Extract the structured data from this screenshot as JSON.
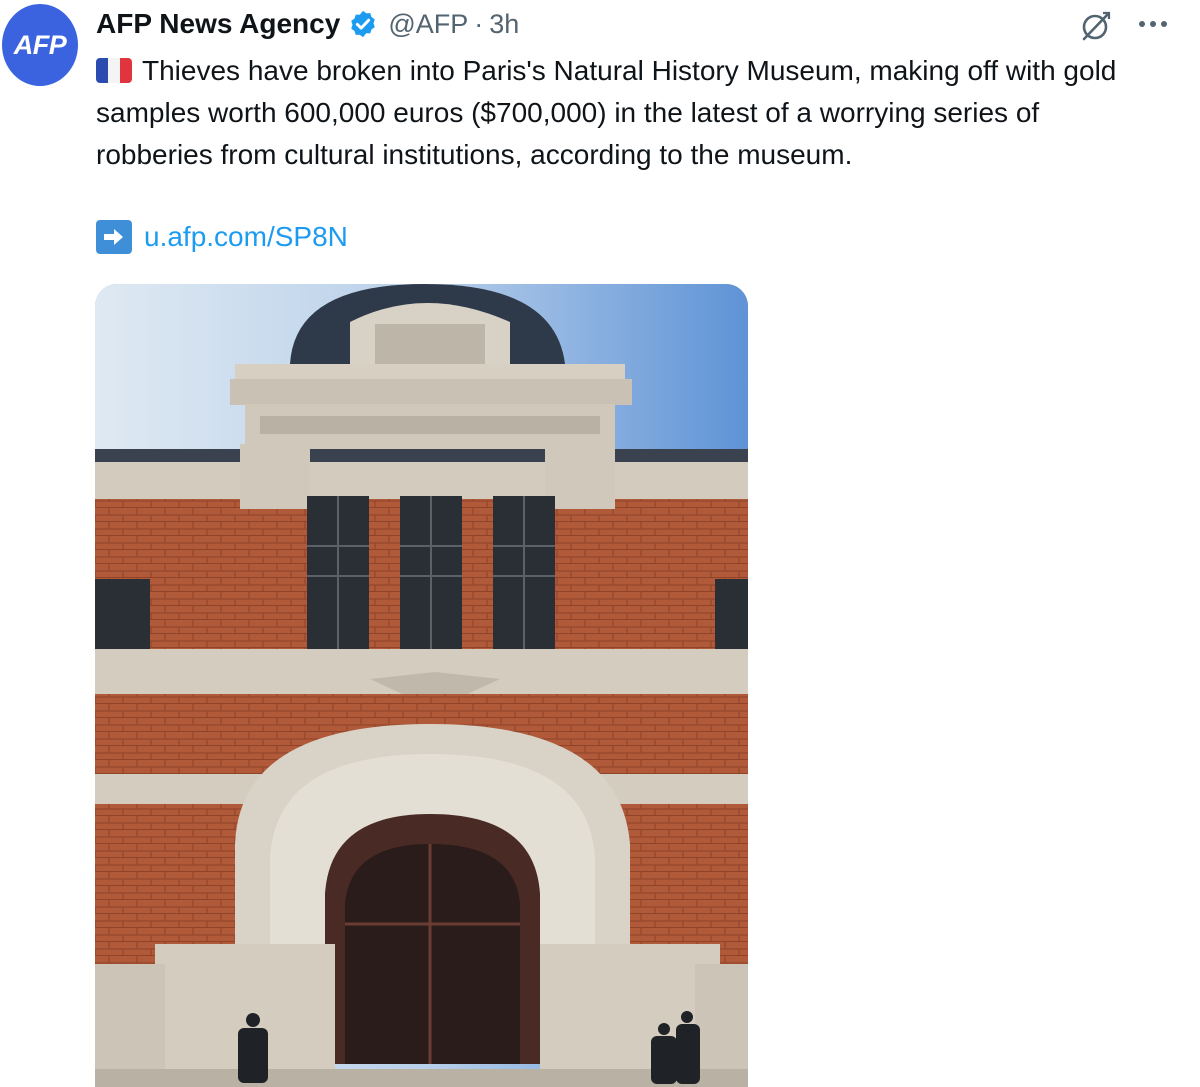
{
  "author": {
    "avatar_text": "AFP",
    "name": "AFP News Agency",
    "handle": "@AFP",
    "separator": "·",
    "time": "3h",
    "verified": true
  },
  "tweet": {
    "flag_icon": "france-flag-icon",
    "text": "Thieves have broken into Paris's Natural History Museum, making off with gold samples worth 600,000 euros ($700,000) in the latest of a worrying series of robberies from cultural institutions, according to the museum.",
    "link_icon": "right-arrow-icon",
    "link": "u.afp.com/SP8N"
  },
  "actions": {
    "grok_icon": "grok-icon",
    "more_icon": "more-options-icon"
  },
  "media": {
    "type": "photo",
    "subject": "museum-facade-photo"
  },
  "colors": {
    "avatar_bg": "#3b63e0",
    "verified": "#1d9bf0",
    "link": "#1d9bf0",
    "secondary_text": "#536471"
  }
}
